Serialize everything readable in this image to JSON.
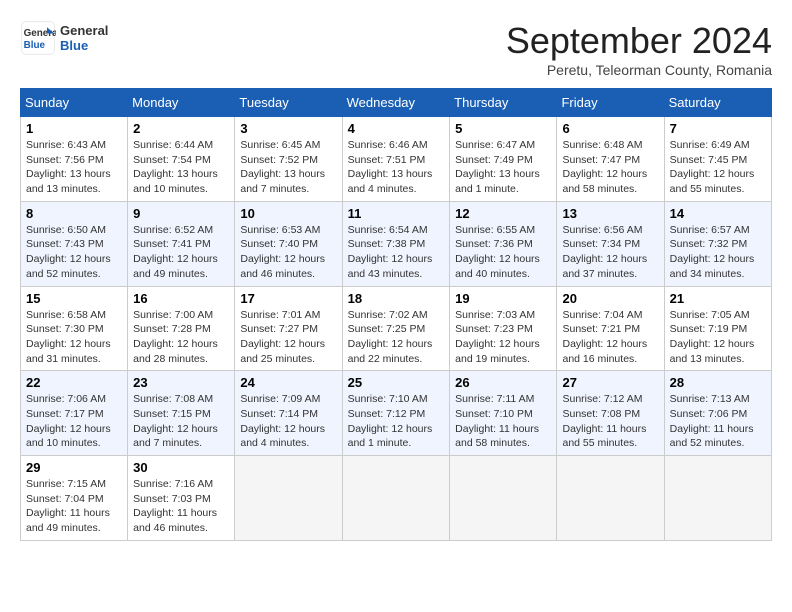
{
  "header": {
    "logo_line1": "General",
    "logo_line2": "Blue",
    "month_title": "September 2024",
    "subtitle": "Peretu, Teleorman County, Romania"
  },
  "weekdays": [
    "Sunday",
    "Monday",
    "Tuesday",
    "Wednesday",
    "Thursday",
    "Friday",
    "Saturday"
  ],
  "weeks": [
    [
      {
        "day": "1",
        "info": "Sunrise: 6:43 AM\nSunset: 7:56 PM\nDaylight: 13 hours\nand 13 minutes."
      },
      {
        "day": "2",
        "info": "Sunrise: 6:44 AM\nSunset: 7:54 PM\nDaylight: 13 hours\nand 10 minutes."
      },
      {
        "day": "3",
        "info": "Sunrise: 6:45 AM\nSunset: 7:52 PM\nDaylight: 13 hours\nand 7 minutes."
      },
      {
        "day": "4",
        "info": "Sunrise: 6:46 AM\nSunset: 7:51 PM\nDaylight: 13 hours\nand 4 minutes."
      },
      {
        "day": "5",
        "info": "Sunrise: 6:47 AM\nSunset: 7:49 PM\nDaylight: 13 hours\nand 1 minute."
      },
      {
        "day": "6",
        "info": "Sunrise: 6:48 AM\nSunset: 7:47 PM\nDaylight: 12 hours\nand 58 minutes."
      },
      {
        "day": "7",
        "info": "Sunrise: 6:49 AM\nSunset: 7:45 PM\nDaylight: 12 hours\nand 55 minutes."
      }
    ],
    [
      {
        "day": "8",
        "info": "Sunrise: 6:50 AM\nSunset: 7:43 PM\nDaylight: 12 hours\nand 52 minutes."
      },
      {
        "day": "9",
        "info": "Sunrise: 6:52 AM\nSunset: 7:41 PM\nDaylight: 12 hours\nand 49 minutes."
      },
      {
        "day": "10",
        "info": "Sunrise: 6:53 AM\nSunset: 7:40 PM\nDaylight: 12 hours\nand 46 minutes."
      },
      {
        "day": "11",
        "info": "Sunrise: 6:54 AM\nSunset: 7:38 PM\nDaylight: 12 hours\nand 43 minutes."
      },
      {
        "day": "12",
        "info": "Sunrise: 6:55 AM\nSunset: 7:36 PM\nDaylight: 12 hours\nand 40 minutes."
      },
      {
        "day": "13",
        "info": "Sunrise: 6:56 AM\nSunset: 7:34 PM\nDaylight: 12 hours\nand 37 minutes."
      },
      {
        "day": "14",
        "info": "Sunrise: 6:57 AM\nSunset: 7:32 PM\nDaylight: 12 hours\nand 34 minutes."
      }
    ],
    [
      {
        "day": "15",
        "info": "Sunrise: 6:58 AM\nSunset: 7:30 PM\nDaylight: 12 hours\nand 31 minutes."
      },
      {
        "day": "16",
        "info": "Sunrise: 7:00 AM\nSunset: 7:28 PM\nDaylight: 12 hours\nand 28 minutes."
      },
      {
        "day": "17",
        "info": "Sunrise: 7:01 AM\nSunset: 7:27 PM\nDaylight: 12 hours\nand 25 minutes."
      },
      {
        "day": "18",
        "info": "Sunrise: 7:02 AM\nSunset: 7:25 PM\nDaylight: 12 hours\nand 22 minutes."
      },
      {
        "day": "19",
        "info": "Sunrise: 7:03 AM\nSunset: 7:23 PM\nDaylight: 12 hours\nand 19 minutes."
      },
      {
        "day": "20",
        "info": "Sunrise: 7:04 AM\nSunset: 7:21 PM\nDaylight: 12 hours\nand 16 minutes."
      },
      {
        "day": "21",
        "info": "Sunrise: 7:05 AM\nSunset: 7:19 PM\nDaylight: 12 hours\nand 13 minutes."
      }
    ],
    [
      {
        "day": "22",
        "info": "Sunrise: 7:06 AM\nSunset: 7:17 PM\nDaylight: 12 hours\nand 10 minutes."
      },
      {
        "day": "23",
        "info": "Sunrise: 7:08 AM\nSunset: 7:15 PM\nDaylight: 12 hours\nand 7 minutes."
      },
      {
        "day": "24",
        "info": "Sunrise: 7:09 AM\nSunset: 7:14 PM\nDaylight: 12 hours\nand 4 minutes."
      },
      {
        "day": "25",
        "info": "Sunrise: 7:10 AM\nSunset: 7:12 PM\nDaylight: 12 hours\nand 1 minute."
      },
      {
        "day": "26",
        "info": "Sunrise: 7:11 AM\nSunset: 7:10 PM\nDaylight: 11 hours\nand 58 minutes."
      },
      {
        "day": "27",
        "info": "Sunrise: 7:12 AM\nSunset: 7:08 PM\nDaylight: 11 hours\nand 55 minutes."
      },
      {
        "day": "28",
        "info": "Sunrise: 7:13 AM\nSunset: 7:06 PM\nDaylight: 11 hours\nand 52 minutes."
      }
    ],
    [
      {
        "day": "29",
        "info": "Sunrise: 7:15 AM\nSunset: 7:04 PM\nDaylight: 11 hours\nand 49 minutes."
      },
      {
        "day": "30",
        "info": "Sunrise: 7:16 AM\nSunset: 7:03 PM\nDaylight: 11 hours\nand 46 minutes."
      },
      {
        "day": "",
        "info": ""
      },
      {
        "day": "",
        "info": ""
      },
      {
        "day": "",
        "info": ""
      },
      {
        "day": "",
        "info": ""
      },
      {
        "day": "",
        "info": ""
      }
    ]
  ]
}
